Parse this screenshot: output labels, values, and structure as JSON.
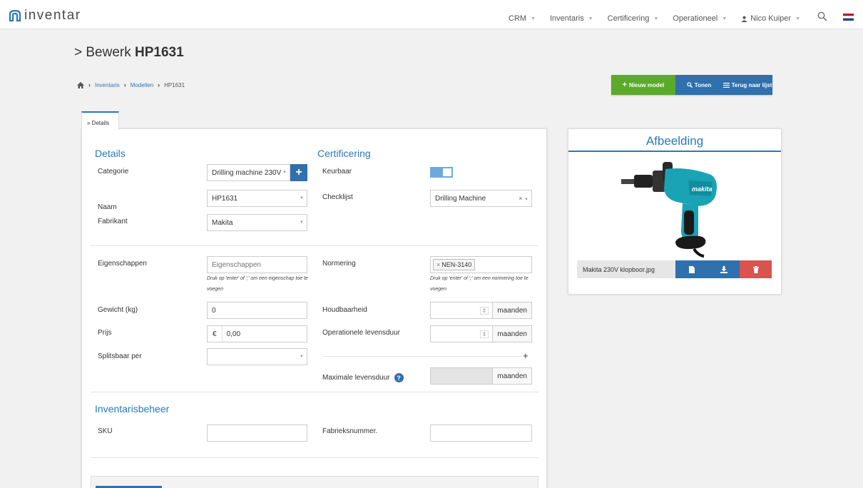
{
  "app": {
    "name": "inventar"
  },
  "nav": {
    "crm": "CRM",
    "inventaris": "Inventaris",
    "certificering": "Certificering",
    "operationeel": "Operationeel",
    "user": "Nico Kuiper"
  },
  "page": {
    "title_prefix": "> Bewerk",
    "title_code": "HP1631"
  },
  "breadcrumb": {
    "items": [
      "Inventaris",
      "Modellen",
      "HP1631"
    ]
  },
  "actions": {
    "new_model": "Nieuw model",
    "show": "Tonen",
    "back": "Terug naar lijst"
  },
  "tabs": {
    "details": "» Details"
  },
  "details": {
    "heading": "Details",
    "categorie_label": "Categorie",
    "categorie_value": "Drilling machine 230V",
    "naam_label": "Naam",
    "naam_value": "HP1631",
    "fabrikant_label": "Fabrikant",
    "fabrikant_value": "Makita",
    "eigenschappen_label": "Eigenschappen",
    "eigenschappen_placeholder": "Eigenschappen",
    "eigenschappen_help": "Druk op 'enter' of ';' om een eigenschap toe te voegen",
    "gewicht_label": "Gewicht (kg)",
    "gewicht_value": "0",
    "prijs_label": "Prijs",
    "prijs_currency": "€",
    "prijs_value": "0,00",
    "splitsbaar_label": "Splitsbaar per"
  },
  "cert": {
    "heading": "Certificering",
    "keurbaar_label": "Keurbaar",
    "keurbaar_on": true,
    "checklijst_label": "Checklijst",
    "checklijst_value": "Drilling Machine",
    "normering_label": "Normering",
    "normering_tag": "NEN-3140",
    "normering_help": "Druk op 'enter' of ';' om een normering toe te voegen",
    "houdbaarheid_label": "Houdbaarheid",
    "operationele_label": "Operationele levensduur",
    "maximale_label": "Maximale levensduur",
    "unit": "maanden"
  },
  "inventarisbeheer": {
    "heading": "Inventarisbeheer",
    "sku_label": "SKU",
    "fabrieksnummer_label": "Fabrieksnummer."
  },
  "image_panel": {
    "title": "Afbeelding",
    "filename": "Makita 230V klopboor.jpg",
    "brand_on_image": "makita"
  },
  "colors": {
    "primary": "#2a79b5",
    "success": "#5aaa2c",
    "danger": "#d9534f"
  }
}
